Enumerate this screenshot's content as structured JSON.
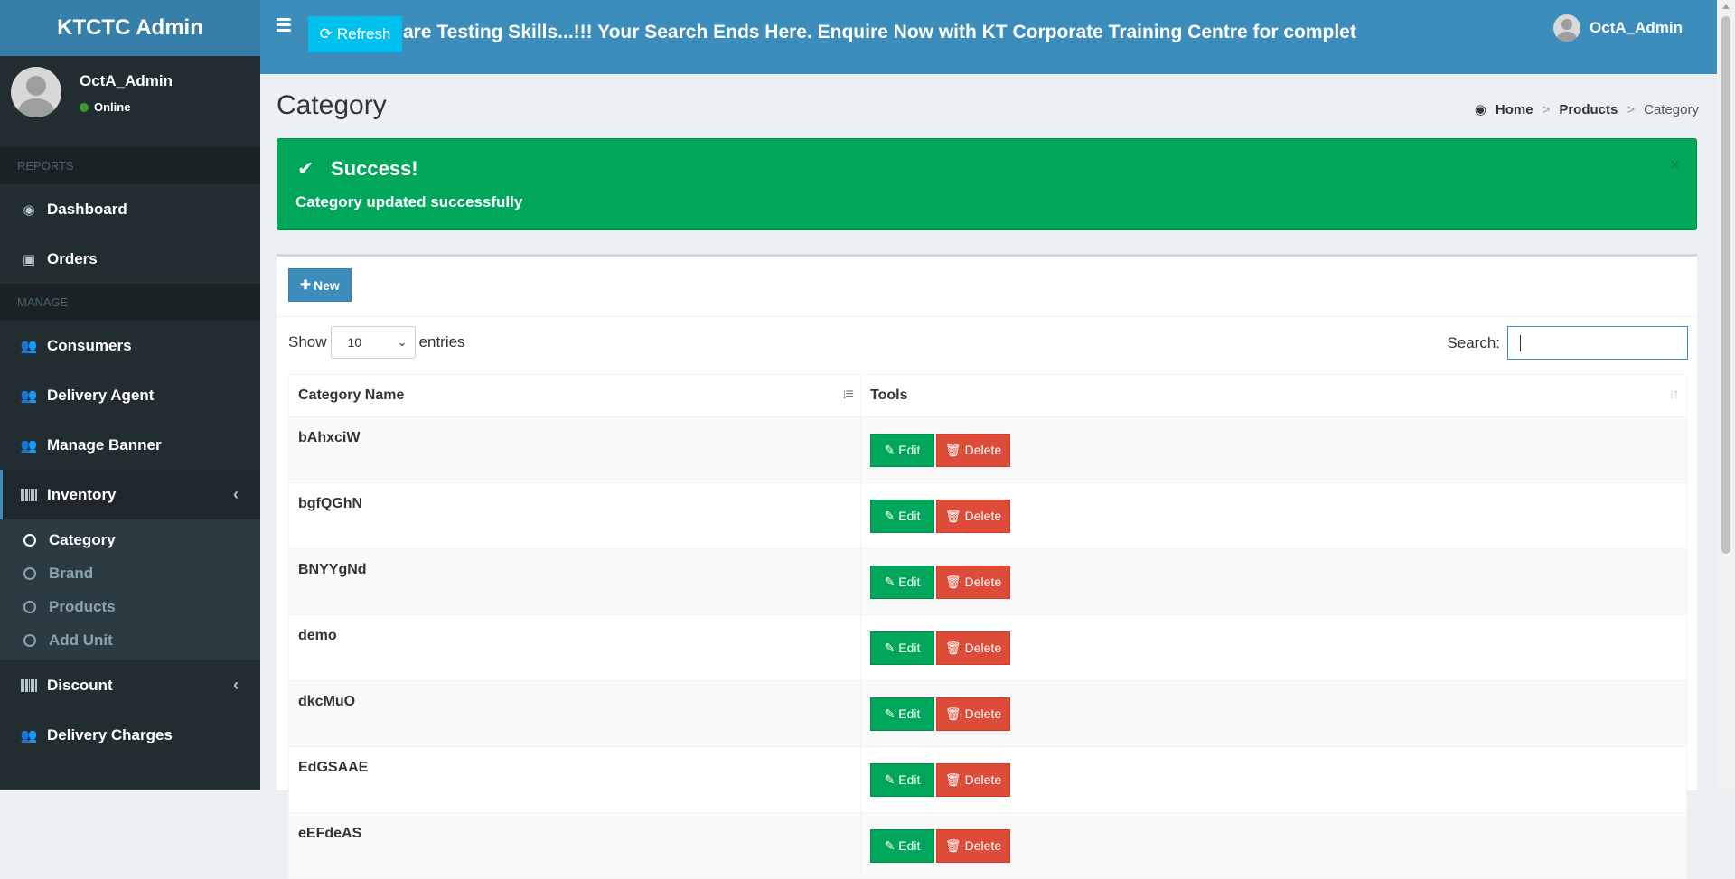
{
  "brand": {
    "title": "KTCTC Admin"
  },
  "topbar": {
    "refresh_label": "Refresh",
    "marquee": "are Testing Skills...!!! Your Search Ends Here. Enquire Now with KT Corporate Training Centre for complet",
    "user_name": "OctA_Admin"
  },
  "sidebar": {
    "user_name": "OctA_Admin",
    "status": "Online",
    "sections": {
      "reports": "REPORTS",
      "manage": "MANAGE"
    },
    "items": {
      "dashboard": "Dashboard",
      "orders": "Orders",
      "consumers": "Consumers",
      "delivery_agent": "Delivery Agent",
      "manage_banner": "Manage Banner",
      "inventory": "Inventory",
      "discount": "Discount",
      "delivery_charges": "Delivery Charges"
    },
    "inventory_sub": [
      "Category",
      "Brand",
      "Products",
      "Add Unit"
    ]
  },
  "page": {
    "title": "Category",
    "breadcrumb": {
      "home": "Home",
      "products": "Products",
      "current": "Category"
    }
  },
  "alert": {
    "title": "Success!",
    "message": "Category updated successfully",
    "close": "×"
  },
  "toolbar": {
    "new_label": "New"
  },
  "table_controls": {
    "show_label": "Show",
    "entries_value": "10",
    "entries_label": "entries",
    "search_label": "Search:",
    "search_value": ""
  },
  "table": {
    "headers": {
      "name": "Category Name",
      "tools": "Tools"
    },
    "edit_label": "Edit",
    "delete_label": "Delete",
    "rows": [
      "bAhxciW",
      "bgfQGhN",
      "BNYYgNd",
      "demo",
      "dkcMuO",
      "EdGSAAE",
      "eEFdeAS"
    ]
  },
  "colors": {
    "header": "#3c8dbc",
    "sidebar": "#222d32",
    "success": "#00a65a",
    "danger": "#dd4b39",
    "info": "#00c0ef"
  }
}
